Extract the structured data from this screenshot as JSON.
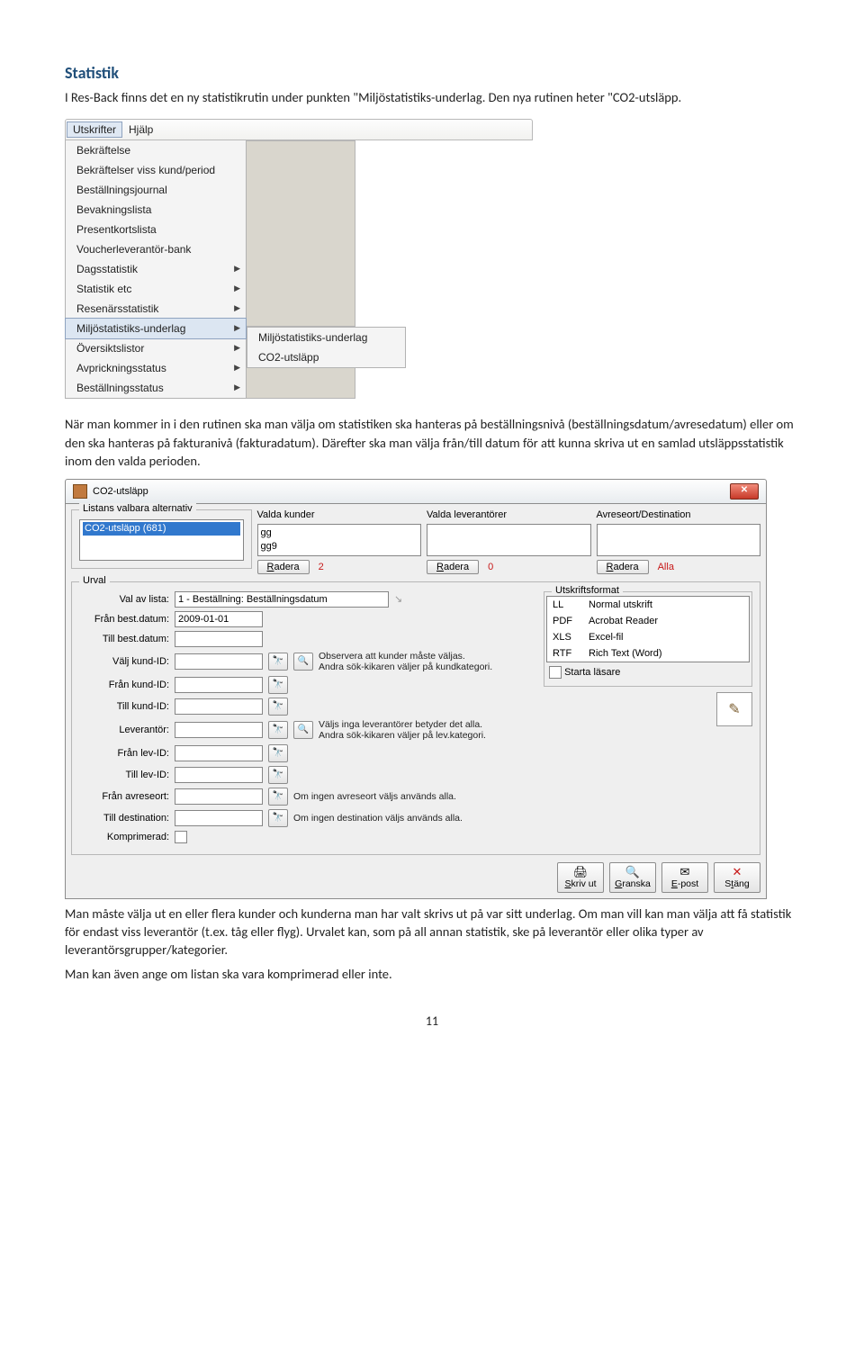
{
  "heading": "Statistik",
  "intro": "I Res-Back finns det en ny statistikrutin under punkten \"Miljöstatistiks-underlag. Den nya rutinen heter \"CO2-utsläpp.",
  "menu": {
    "tabs": [
      "Utskrifter",
      "Hjälp"
    ],
    "items": [
      {
        "label": "Bekräftelse",
        "arrow": false
      },
      {
        "label": "Bekräftelser viss kund/period",
        "arrow": false
      },
      {
        "label": "Beställningsjournal",
        "arrow": false
      },
      {
        "label": "Bevakningslista",
        "arrow": false
      },
      {
        "label": "Presentkortslista",
        "arrow": false
      },
      {
        "label": "Voucherleverantör-bank",
        "arrow": false
      },
      {
        "label": "Dagsstatistik",
        "arrow": true
      },
      {
        "label": "Statistik etc",
        "arrow": true
      },
      {
        "label": "Resenärsstatistik",
        "arrow": true
      },
      {
        "label": "Miljöstatistiks-underlag",
        "arrow": true,
        "sel": true
      },
      {
        "label": "Översiktslistor",
        "arrow": true
      },
      {
        "label": "Avprickningsstatus",
        "arrow": true
      },
      {
        "label": "Beställningsstatus",
        "arrow": true
      }
    ],
    "sub": [
      "Miljöstatistiks-underlag",
      "CO2-utsläpp"
    ]
  },
  "para2": "När man kommer in i den rutinen ska man välja om statistiken ska hanteras på beställningsnivå (beställningsdatum/avresedatum) eller om den ska hanteras på fakturanivå (fakturadatum). Därefter ska man välja från/till datum för att kunna skriva ut en samlad utsläppsstatistik inom den valda perioden.",
  "dialog": {
    "title": "CO2-utsläpp",
    "group1": "Listans valbara alternativ",
    "g1item": "CO2-utsläpp (681)",
    "g2": "Valda kunder",
    "g2items": "gg\ngg9",
    "g3": "Valda leverantörer",
    "g4": "Avreseort/Destination",
    "radera": "Radera",
    "c2": "2",
    "c3": "0",
    "alla": "Alla",
    "urval": "Urval",
    "rows": {
      "r1": {
        "lbl": "Val av lista:",
        "val": "1 - Beställning: Beställningsdatum"
      },
      "r2": {
        "lbl": "Från best.datum:",
        "val": "2009-01-01"
      },
      "r3": {
        "lbl": "Till best.datum:"
      },
      "r4": {
        "lbl": "Välj kund-ID:",
        "note": "Observera att kunder måste väljas.\nAndra sök-kikaren väljer på kundkategori."
      },
      "r5": {
        "lbl": "Från kund-ID:"
      },
      "r6": {
        "lbl": "Till kund-ID:"
      },
      "r7": {
        "lbl": "Leverantör:",
        "note": "Väljs inga leverantörer betyder det alla.\nAndra sök-kikaren väljer på lev.kategori."
      },
      "r8": {
        "lbl": "Från lev-ID:"
      },
      "r9": {
        "lbl": "Till lev-ID:"
      },
      "r10": {
        "lbl": "Från avreseort:",
        "note": "Om ingen avreseort väljs används alla."
      },
      "r11": {
        "lbl": "Till destination:",
        "note": "Om ingen destination väljs används alla."
      },
      "r12": {
        "lbl": "Komprimerad:"
      }
    },
    "out": {
      "legend": "Utskriftsformat",
      "rows": [
        {
          "a": "LL",
          "b": "Normal utskrift"
        },
        {
          "a": "PDF",
          "b": "Acrobat Reader"
        },
        {
          "a": "XLS",
          "b": "Excel-fil"
        },
        {
          "a": "RTF",
          "b": "Rich Text (Word)"
        }
      ],
      "starta": "Starta läsare"
    },
    "actions": {
      "skriv": "Skriv ut",
      "granska": "Granska",
      "epost": "E-post",
      "stang": "Stäng"
    }
  },
  "para3": "Man måste välja ut en eller flera kunder och kunderna man har valt skrivs ut på var sitt underlag. Om man vill kan man välja att få statistik för endast viss leverantör (t.ex. tåg eller flyg). Urvalet kan, som på all annan statistik, ske på leverantör eller olika typer av leverantörsgrupper/kategorier.",
  "para4": "Man kan även ange om listan ska vara komprimerad eller inte.",
  "page": "11"
}
